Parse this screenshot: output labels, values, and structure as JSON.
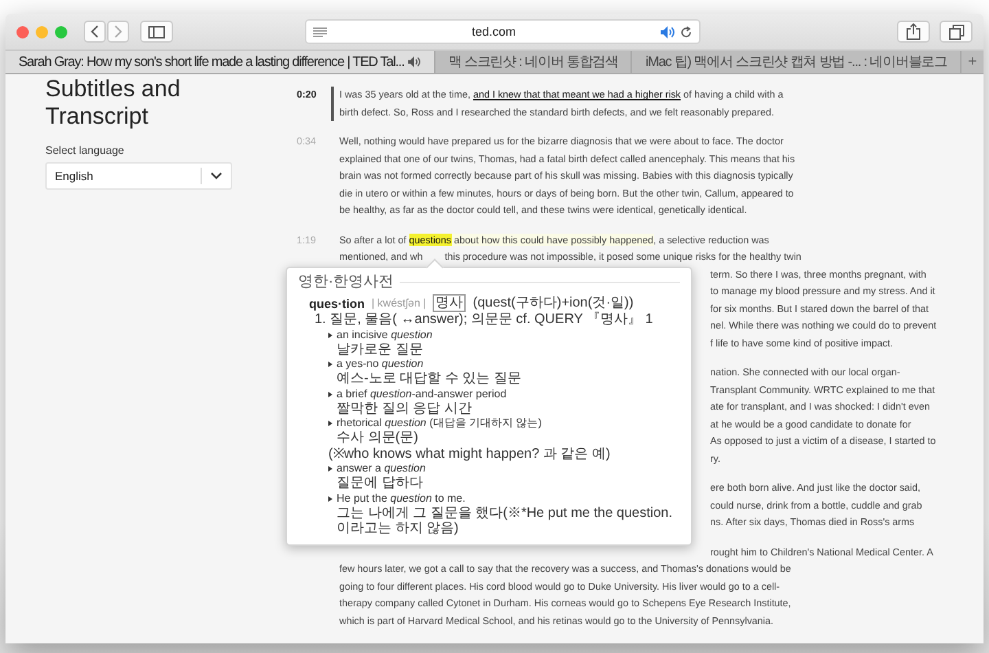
{
  "browser": {
    "address": "ted.com",
    "tabs": [
      {
        "title": "Sarah Gray: How my son's short life made a lasting difference | TED Tal...",
        "selected": true,
        "audio": true
      },
      {
        "title": "맥 스크린샷 : 네이버 통합검색",
        "selected": false,
        "audio": false
      },
      {
        "title": "iMac 팁) 맥에서 스크린샷 캡쳐 방법 -... : 네이버블로그",
        "selected": false,
        "audio": false
      }
    ],
    "new_tab": "+"
  },
  "sidebar": {
    "title": "Subtitles and Transcript",
    "language_label": "Select language",
    "language": "English"
  },
  "transcript": [
    {
      "time": "0:20",
      "current": true,
      "lines": [
        {
          "kind": "full",
          "text": "I was 35 years old at the time, **and I knew that that meant we had a higher risk** of having a child with a"
        },
        {
          "kind": "full",
          "text": "birth defect. So, Ross and I researched the standard birth defects, and we felt reasonably prepared."
        }
      ]
    },
    {
      "time": "0:34",
      "current": false,
      "lines": [
        {
          "kind": "full",
          "text": "Well, nothing would have prepared us for the bizarre diagnosis that we were about to face. The doctor"
        },
        {
          "kind": "full",
          "text": "explained that one of our twins, Thomas, had a fatal birth defect called anencephaly. This means that his"
        },
        {
          "kind": "full",
          "text": "brain was not formed correctly because part of his skull was missing. Babies with this diagnosis typically"
        },
        {
          "kind": "full",
          "text": "die in utero or within a few minutes, hours or days of being born. But the other twin, Callum, appeared to"
        },
        {
          "kind": "full",
          "text": "be healthy, as far as the doctor could tell, and these twins were identical, genetically identical."
        }
      ]
    },
    {
      "time": "1:19",
      "current": false,
      "lines": [
        {
          "kind": "marked",
          "parts": [
            {
              "text": "So after a lot of ",
              "selected": false,
              "active": false
            },
            {
              "text": "questions",
              "selected": true,
              "active": false
            },
            {
              "text": " about how this could have possibly happened",
              "selected": false,
              "active": true
            },
            {
              "text": ", a selective reduction was",
              "selected": false,
              "active": false
            }
          ]
        },
        {
          "kind": "notched",
          "left": "mentioned, and wh",
          "right": "this procedure was not impossible, it posed some unique risks for the healthy twin"
        },
        {
          "kind": "covered",
          "text": "term. So there I was, three months pregnant, with"
        },
        {
          "kind": "covered",
          "text": "to manage my blood pressure and my stress. And it"
        },
        {
          "kind": "covered",
          "text": "for six months. But I stared down the barrel of that"
        },
        {
          "kind": "covered",
          "text": "nel. While there was nothing we could do to prevent"
        },
        {
          "kind": "covered",
          "text": "f life to have some kind of positive impact."
        }
      ]
    },
    {
      "lines": [
        {
          "kind": "covered",
          "text": "nation. She connected with our local organ-"
        },
        {
          "kind": "covered",
          "text": "Transplant Community. WRTC explained to me that"
        },
        {
          "kind": "covered",
          "text": "ate for transplant, and I was shocked: I didn't even"
        },
        {
          "kind": "covered",
          "text": "at he would be a good candidate to donate for"
        },
        {
          "kind": "covered",
          "text": "As opposed to just a victim of a disease, I started to"
        },
        {
          "kind": "covered",
          "text": "ry."
        }
      ]
    },
    {
      "lines": [
        {
          "kind": "covered",
          "text": "ere both born alive. And just like the doctor said,"
        },
        {
          "kind": "covered",
          "text": "could nurse, drink from a bottle, cuddle and grab"
        },
        {
          "kind": "covered",
          "text": "ns. After six days, Thomas died in Ross's arms"
        }
      ]
    },
    {
      "current": false,
      "lines": [
        {
          "kind": "covered",
          "text": "rought him to Children's National Medical Center. A"
        },
        {
          "kind": "full",
          "text": "few hours later, we got a call to say that the recovery was a success, and Thomas's donations would be"
        },
        {
          "kind": "full",
          "text": "going to four different places. His cord blood would go to Duke University. His liver would go to a cell-"
        },
        {
          "kind": "full",
          "text": "therapy company called Cytonet in Durham. His corneas would go to Schepens Eye Research Institute,"
        },
        {
          "kind": "full",
          "text": "which is part of Harvard Medical School, and his retinas would go to the University of Pennsylvania."
        }
      ]
    }
  ],
  "dictionary": {
    "title": "영한·한영사전",
    "headword": "ques·tion",
    "pronunciation": "| kwéstʃən |",
    "pos": "명사",
    "etymology": "(quest(구하다)+ion(것·일))",
    "sense": "1. 질문, 물음( ↔answer); 의문문  cf. QUERY 『명사』 1",
    "examples": [
      {
        "en": "an incisive *question*",
        "ko": "날카로운 질문"
      },
      {
        "en": "a yes-no *question*",
        "ko": "예스-노로 대답할 수 있는 질문"
      },
      {
        "en": "a brief *question*-and-answer period",
        "ko": "짤막한 질의 응답 시간"
      },
      {
        "en": "rhetorical *question* (대답을 기대하지 않는)",
        "ko": "수사 의문(문)",
        "note": "(※who knows what might happen? 과 같은 예)"
      },
      {
        "en": "answer a *question*",
        "ko": "질문에 답하다"
      },
      {
        "en": "He put the *question* to me.",
        "ko": "그는 나에게 그 질문을 했다(※*He put me the question. 이라고는 하지 않음)"
      }
    ]
  }
}
